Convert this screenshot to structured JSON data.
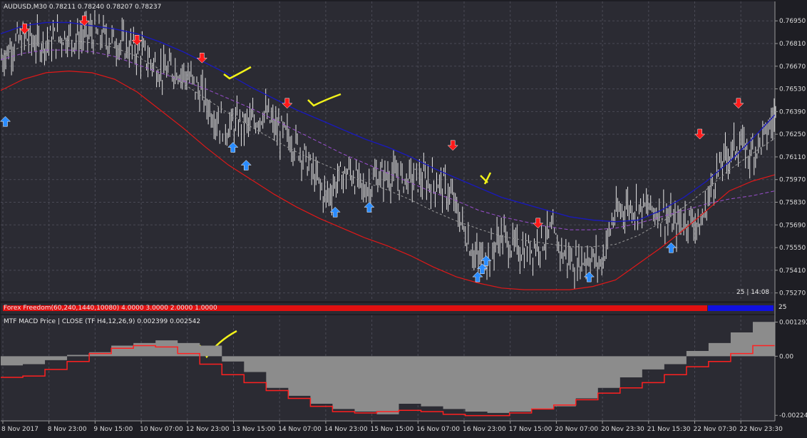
{
  "window": {
    "symbol_title": "AUDUSD,M30  0.78211 0.78240 0.78207 0.78237"
  },
  "indicator": {
    "title": "Forex Freedom(60,240,1440,10080) 4.0000 3.0000 2.0000 1.0000",
    "right_tag": "25"
  },
  "macd": {
    "title": "MTF MACD Price | CLOSE  (TF H4,12,26,9) 0.002399 0.002542"
  },
  "timer": "25 | 14:08",
  "colors": {
    "background": "#2b2b33",
    "grid": "#4a4a55",
    "price": "#e6e6e6",
    "blue_ma": "#1a1ab8",
    "red_ma": "#e01818",
    "purple_ma": "#9b4fd0",
    "gray_ma": "#9a9a9a",
    "buy_arrow": "#2a8cff",
    "sell_arrow": "#ff1a1a",
    "hist": "#8c8c8c",
    "signal": "#ff2020",
    "annotation": "#f2f21a"
  },
  "chart_data": [
    {
      "type": "line",
      "title": "AUDUSD,M30",
      "xlabel": "",
      "ylabel": "",
      "x": [
        "8 Nov 2017",
        "8 Nov 23:00",
        "9 Nov 15:00",
        "10 Nov 07:00",
        "12 Nov 23:00",
        "13 Nov 15:00",
        "14 Nov 07:00",
        "14 Nov 23:00",
        "15 Nov 15:00",
        "16 Nov 07:00",
        "16 Nov 23:00",
        "17 Nov 15:00",
        "20 Nov 07:00",
        "20 Nov 23:30",
        "21 Nov 15:30",
        "22 Nov 07:30",
        "22 Nov 23:30"
      ],
      "yticks": [
        "0.76950",
        "0.76810",
        "0.76670",
        "0.76530",
        "0.76390",
        "0.76250",
        "0.76110",
        "0.75970",
        "0.75830",
        "0.75690",
        "0.75550",
        "0.75410",
        "0.75270"
      ],
      "ylim": [
        0.7522,
        0.7707
      ],
      "series": [
        {
          "name": "",
          "values": [
            0.7672,
            0.7681,
            0.7684,
            0.7681,
            0.7683,
            0.7686,
            0.7684,
            0.7687,
            0.7686,
            0.7683,
            0.7679,
            0.7676,
            0.767,
            0.7663,
            0.7666,
            0.766,
            0.765,
            0.7637,
            0.7629,
            0.7632,
            0.7631,
            0.7639,
            0.7628,
            0.7623,
            0.7615,
            0.76,
            0.7586,
            0.7598,
            0.7602,
            0.759,
            0.7598,
            0.76,
            0.7597,
            0.7598,
            0.7596,
            0.7595,
            0.7587,
            0.7567,
            0.7548,
            0.755,
            0.7563,
            0.7555,
            0.7553,
            0.7558,
            0.7564,
            0.7551,
            0.7545,
            0.755,
            0.7545,
            0.7573,
            0.7581,
            0.758,
            0.7579,
            0.7576,
            0.7568,
            0.7574,
            0.7568,
            0.7596,
            0.7611,
            0.7619,
            0.7613,
            0.7622,
            0.7637
          ]
        },
        {
          "name": "",
          "values": [
            0.7687,
            0.7692,
            0.7694,
            0.7694,
            0.7692,
            0.769,
            0.7687,
            0.7682,
            0.7676,
            0.7669,
            0.7662,
            0.7654,
            0.7647,
            0.764,
            0.7634,
            0.7628,
            0.7622,
            0.7617,
            0.7611,
            0.7604,
            0.7598,
            0.7592,
            0.7586,
            0.7582,
            0.7578,
            0.7574,
            0.7572,
            0.7571,
            0.7572,
            0.7578,
            0.7586,
            0.7596,
            0.7608,
            0.7622,
            0.7637
          ]
        },
        {
          "name": "",
          "values": [
            0.7652,
            0.7659,
            0.7663,
            0.7664,
            0.7663,
            0.7659,
            0.7651,
            0.764,
            0.7629,
            0.7617,
            0.7606,
            0.7597,
            0.7588,
            0.758,
            0.7573,
            0.7567,
            0.7561,
            0.7556,
            0.755,
            0.7543,
            0.7537,
            0.7533,
            0.753,
            0.7529,
            0.7529,
            0.7529,
            0.7531,
            0.7535,
            0.7545,
            0.7555,
            0.7566,
            0.7578,
            0.759,
            0.7596,
            0.76
          ]
        },
        {
          "name": "",
          "values": [
            0.7671,
            0.7675,
            0.7677,
            0.7677,
            0.7676,
            0.7673,
            0.7668,
            0.7663,
            0.7658,
            0.7653,
            0.7647,
            0.7641,
            0.7634,
            0.7627,
            0.762,
            0.7613,
            0.7607,
            0.7601,
            0.7595,
            0.7589,
            0.7584,
            0.7578,
            0.7574,
            0.7571,
            0.7568,
            0.7566,
            0.7566,
            0.7567,
            0.757,
            0.7574,
            0.7578,
            0.7582,
            0.7585,
            0.7587,
            0.759
          ]
        }
      ],
      "buy_signals": [
        [
          0.006,
          0.7636
        ],
        [
          0.3,
          0.762
        ],
        [
          0.317,
          0.7609
        ],
        [
          0.432,
          0.758
        ],
        [
          0.476,
          0.7583
        ],
        [
          0.616,
          0.754
        ],
        [
          0.622,
          0.7545
        ],
        [
          0.627,
          0.755
        ],
        [
          0.76,
          0.754
        ],
        [
          0.866,
          0.7558
        ]
      ],
      "sell_signals": [
        [
          0.031,
          0.7687
        ],
        [
          0.108,
          0.7692
        ],
        [
          0.176,
          0.768
        ],
        [
          0.26,
          0.7669
        ],
        [
          0.37,
          0.7641
        ],
        [
          0.584,
          0.7615
        ],
        [
          0.694,
          0.7567
        ],
        [
          0.903,
          0.7622
        ],
        [
          0.953,
          0.7641
        ]
      ]
    },
    {
      "type": "bar",
      "title": "MTF MACD Price | CLOSE (TF H4,12,26,9)",
      "yticks": [
        "0.001292",
        "0.00",
        "-0.00224"
      ],
      "ylim": [
        -0.00245,
        0.00155
      ],
      "histogram": [
        -0.00035,
        -0.0003,
        -0.00015,
        5e-05,
        0.00015,
        0.0004,
        0.0005,
        0.0006,
        0.0005,
        0.0004,
        -0.0002,
        -0.0006,
        -0.0012,
        -0.0015,
        -0.0018,
        -0.002,
        -0.0021,
        -0.0022,
        -0.0018,
        -0.0019,
        -0.002,
        -0.0021,
        -0.00215,
        -0.0021,
        -0.002,
        -0.0019,
        -0.0016,
        -0.0012,
        -0.0008,
        -0.0005,
        -0.0003,
        0.0002,
        0.0005,
        0.0009,
        0.0013
      ],
      "signal": [
        -0.0008,
        -0.00075,
        -0.0005,
        -0.0002,
        0.0001,
        0.0003,
        0.0004,
        0.00035,
        0.0001,
        -0.0003,
        -0.0007,
        -0.001,
        -0.0013,
        -0.0016,
        -0.0019,
        -0.0021,
        -0.00215,
        -0.0021,
        -0.00205,
        -0.0021,
        -0.0022,
        -0.00225,
        -0.00225,
        -0.00215,
        -0.002,
        -0.00185,
        -0.00165,
        -0.0014,
        -0.0012,
        -0.001,
        -0.0007,
        -0.0004,
        -0.0002,
        0.0001,
        0.0004
      ]
    }
  ]
}
